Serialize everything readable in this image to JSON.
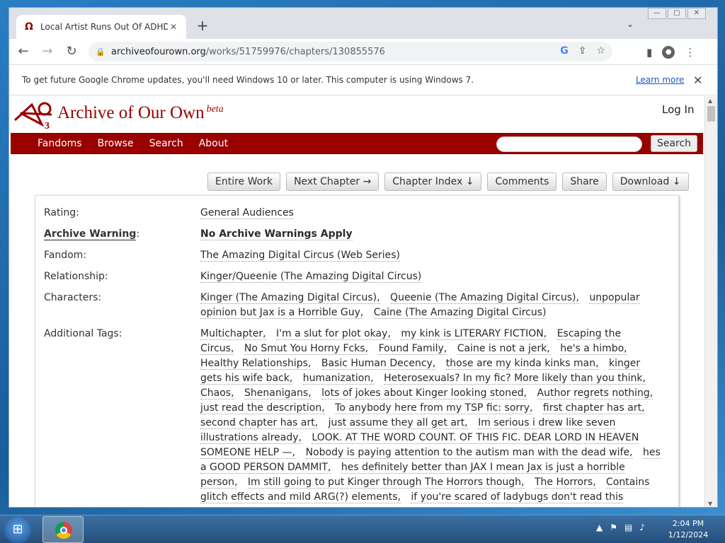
{
  "browser": {
    "tab_title": "Local Artist Runs Out Of ADHD M",
    "tab_close": "✕",
    "new_tab": "+",
    "url_host": "archiveofourown.org",
    "url_path": "/works/51759976/chapters/130855576",
    "window_controls": [
      "—",
      "▢",
      "✕"
    ],
    "infobar_text": "To get future Google Chrome updates, you'll need Windows 10 or later. This computer is using Windows 7.",
    "infobar_link": "Learn more",
    "infobar_close": "✕"
  },
  "site": {
    "name": "Archive of Our Own",
    "beta": "beta",
    "login": "Log In",
    "nav": [
      "Fandoms",
      "Browse",
      "Search",
      "About"
    ],
    "search_button": "Search"
  },
  "actions": [
    "Entire Work",
    "Next Chapter →",
    "Chapter Index ↓",
    "Comments",
    "Share",
    "Download ↓"
  ],
  "meta": {
    "rating_label": "Rating:",
    "rating": "General Audiences",
    "warning_label": "Archive Warning",
    "warning_colon": ":",
    "warning": "No Archive Warnings Apply",
    "fandom_label": "Fandom:",
    "fandom": "The Amazing Digital Circus (Web Series)",
    "relationship_label": "Relationship:",
    "relationship": "Kinger/Queenie (The Amazing Digital Circus)",
    "characters_label": "Characters:",
    "characters": [
      "Kinger (The Amazing Digital Circus),",
      "Queenie (The Amazing Digital Circus),",
      "unpopular opinion but Jax is a Horrible Guy,",
      "Caine (The Amazing Digital Circus)"
    ],
    "tags_label": "Additional Tags:",
    "tags": [
      "Multichapter,",
      "I'm a slut for plot okay,",
      "my kink is LITERARY FICTION,",
      "Escaping the Circus,",
      "No Smut You Horny Fcks,",
      "Found Family,",
      "Caine is not a jerk,",
      "he's a himbo,",
      "Healthy Relationships,",
      "Basic Human Decency,",
      "those are my kinda kinks man,",
      "kinger gets his wife back,",
      "humanization,",
      "Heterosexuals? In my fic? More likely than you think,",
      "Chaos,",
      "Shenanigans,",
      "lots of jokes about Kinger looking stoned,",
      "Author regrets nothing,",
      "just read the description,",
      "To anybody here from my TSP fic: sorry,",
      "first chapter has art,",
      "second chapter has art,",
      "just assume they all get art,",
      "Im serious i drew like seven illustrations already,",
      "LOOK. AT THE WORD COUNT. OF THIS FIC. DEAR LORD IN HEAVEN SOMEONE HELP —,",
      "Nobody is paying attention to the autism man with the dead wife,",
      "hes a GOOD PERSON DAMMIT,",
      "hes definitely better than JAX I mean Jax is just a horrible person,",
      "Im still going to put Kinger through The Horrors though,",
      "The Horrors,",
      "Contains glitch effects and mild ARG(?) elements,",
      "if you're scared of ladybugs don't read this"
    ]
  },
  "taskbar": {
    "time": "2:04 PM",
    "date": "1/12/2024"
  }
}
